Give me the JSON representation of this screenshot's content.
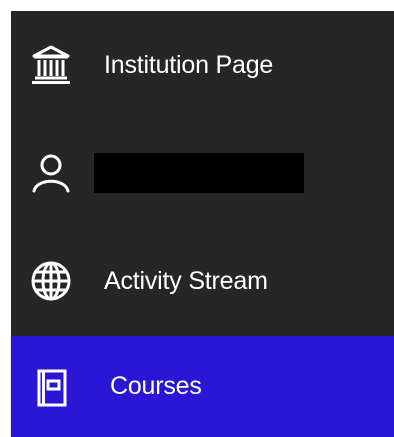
{
  "nav": {
    "items": [
      {
        "label": "Institution Page",
        "icon": "institution-icon",
        "active": false
      },
      {
        "label": "",
        "icon": "user-icon",
        "active": false,
        "redacted": true
      },
      {
        "label": "Activity Stream",
        "icon": "globe-icon",
        "active": false
      },
      {
        "label": "Courses",
        "icon": "courses-icon",
        "active": true
      }
    ]
  },
  "colors": {
    "nav_background": "#262626",
    "active_background": "#2a16d4",
    "text": "#ffffff"
  }
}
